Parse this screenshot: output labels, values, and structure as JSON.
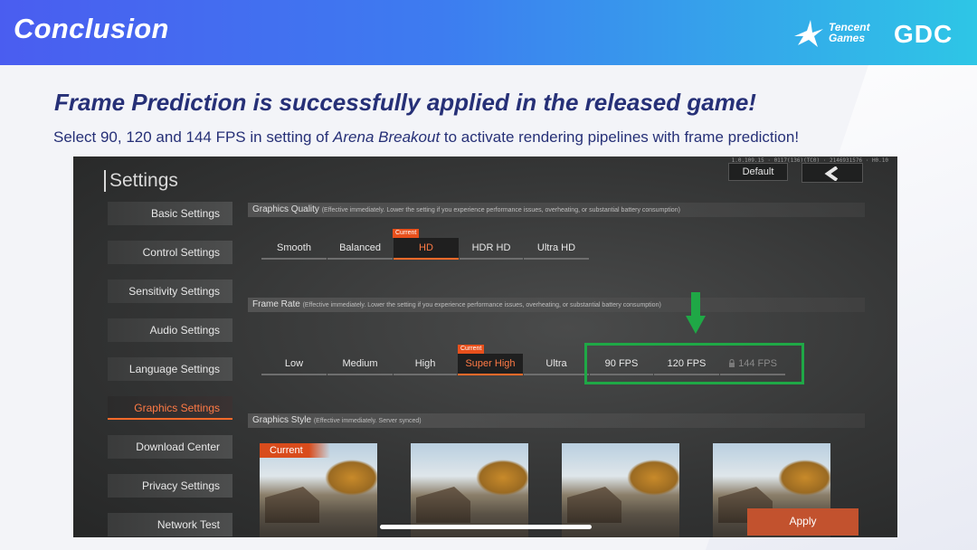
{
  "slide": {
    "title": "Conclusion",
    "logo_tencent_line1": "Tencent",
    "logo_tencent_line2": "Games",
    "logo_gdc": "GDC",
    "subtitle": "Frame Prediction is successfully applied in the released game!",
    "caption_before": "Select 90, 120 and 144 FPS in setting of ",
    "caption_em": "Arena Breakout",
    "caption_after": "  to activate rendering pipelines with frame prediction!"
  },
  "game": {
    "top_info": "1.0.109.15 · 0117(136)(TC0) · 2146931576 · H0.10",
    "settings_title": "Settings",
    "default_label": "Default",
    "back_icon": "chevron-left-icon",
    "sidebar": [
      {
        "label": "Basic Settings",
        "active": false
      },
      {
        "label": "Control Settings",
        "active": false
      },
      {
        "label": "Sensitivity Settings",
        "active": false
      },
      {
        "label": "Audio Settings",
        "active": false
      },
      {
        "label": "Language Settings",
        "active": false
      },
      {
        "label": "Graphics Settings",
        "active": true
      },
      {
        "label": "Download Center",
        "active": false
      },
      {
        "label": "Privacy Settings",
        "active": false
      },
      {
        "label": "Network Test",
        "active": false
      }
    ],
    "graphics_quality": {
      "title": "Graphics Quality",
      "note": "(Effective immediately. Lower the setting if you experience performance issues, overheating, or substantial battery consumption)",
      "current_tag": "Current",
      "options": [
        "Smooth",
        "Balanced",
        "HD",
        "HDR HD",
        "Ultra HD"
      ],
      "selected": "HD"
    },
    "frame_rate": {
      "title": "Frame Rate",
      "note": "(Effective immediately. Lower the setting if you experience performance issues, overheating, or substantial battery consumption)",
      "current_tag": "Current",
      "options": [
        "Low",
        "Medium",
        "High",
        "Super High",
        "Ultra",
        "90 FPS",
        "120 FPS",
        "144 FPS"
      ],
      "selected": "Super High",
      "locked": "144 FPS",
      "lock_icon": "lock-icon"
    },
    "graphics_style": {
      "title": "Graphics Style",
      "note": "(Effective immediately. Server synced)",
      "current_tag": "Current",
      "card_count": 4
    },
    "apply_label": "Apply"
  },
  "colors": {
    "accent_orange": "#ff6a2a",
    "highlight_green": "#1fa846",
    "slide_navy": "#263077"
  }
}
